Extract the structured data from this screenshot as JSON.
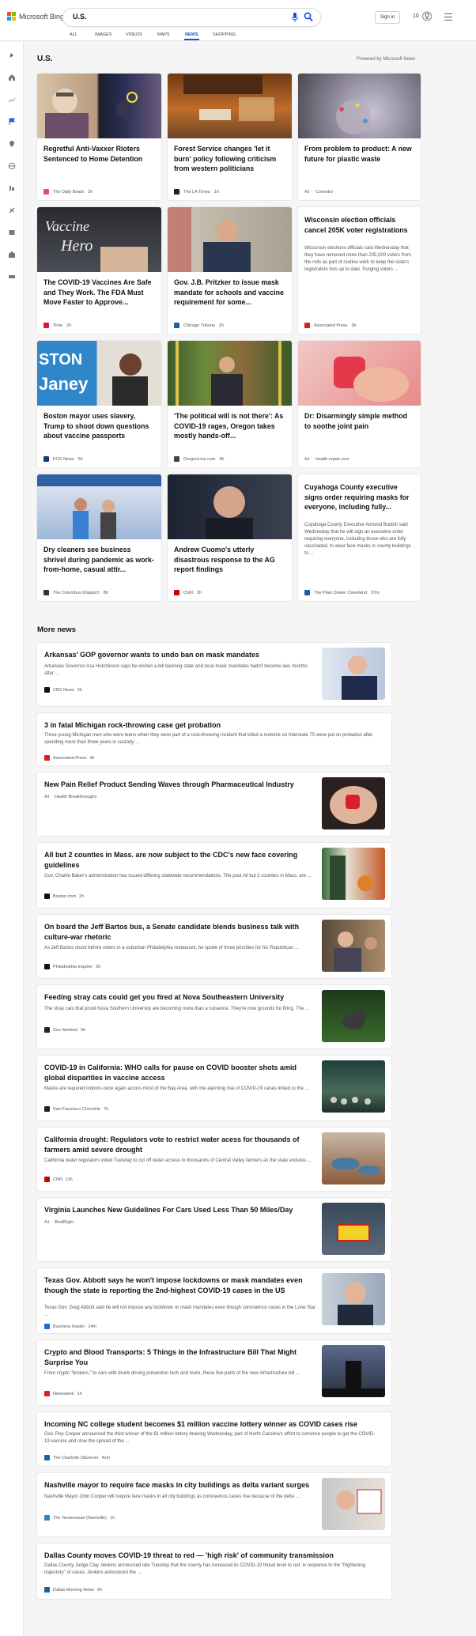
{
  "header": {
    "brand": "Microsoft Bing",
    "query": "U.S.",
    "signin": "Sign in",
    "points": "10",
    "tabs": [
      "ALL",
      "IMAGES",
      "VIDEOS",
      "MAPS",
      "NEWS",
      "SHOPPING"
    ],
    "active_tab": "NEWS"
  },
  "section": {
    "title": "U.S.",
    "powered": "Powered by Microsoft News",
    "more_news": "More news"
  },
  "cards": [
    {
      "title": "Regretful Anti-Vaxxer Rioters Sentenced to Home Detention",
      "source": "The Daily Beast",
      "time": "1h",
      "fav_color": "#e74c6d"
    },
    {
      "title": "Forest Service changes 'let it burn' policy following criticism from western politicians",
      "source": "The LA Times",
      "time": "1h",
      "fav_color": "#222222"
    },
    {
      "title": "From problem to product: A new future for plastic waste",
      "ad": "Ad",
      "source": "Covestro",
      "time": ""
    },
    {
      "title": "The COVID-19 Vaccines Are Safe and They Work. The FDA Must Move Faster to Approve...",
      "source": "Time",
      "time": "2h",
      "fav_color": "#d81b28"
    },
    {
      "title": "Gov. J.B. Pritzker to issue mask mandate for schools and vaccine requirement for some...",
      "source": "Chicago Tribune",
      "time": "2h",
      "fav_color": "#1c5fa8"
    },
    {
      "title": "Wisconsin election officials cancel 205K voter registrations",
      "desc": "Wisconsin elections officials said Wednesday that they have removed more than 205,000 voters from the rolls as part of routine work to keep the state's registration lists up to date. Purging voters ...",
      "source": "Associated Press",
      "time": "3h",
      "fav_color": "#d6202a"
    },
    {
      "title": "Boston mayor uses slavery, Trump to shoot down questions about vaccine passports",
      "source": "FOX News",
      "time": "5h",
      "fav_color": "#173a7c"
    },
    {
      "title": "'The political will is not there': As COVID-19 rages, Oregon takes mostly hands-off...",
      "source": "OregonLive.com",
      "time": "4h",
      "fav_color": "#444444"
    },
    {
      "title": "Dr: Disarmingly simple method to soothe joint pain",
      "ad": "Ad",
      "source": "health-repair.com",
      "time": ""
    },
    {
      "title": "Dry cleaners see business shrivel during pandemic as work-from-home, casual attir...",
      "source": "The Columbus Dispatch",
      "time": "8h",
      "fav_color": "#333333"
    },
    {
      "title": "Andrew Cuomo's utterly disastrous response to the AG report findings",
      "source": "CNN",
      "time": "2h",
      "fav_color": "#cc0000"
    },
    {
      "title": "Cuyahoga County executive signs order requiring masks for everyone, including fully...",
      "desc": "Cuyahoga County Executive Armond Budish said Wednesday that he will sign an executive order requiring everyone, including those who are fully vaccinated, to wear face masks in county buildings to ...",
      "source": "The Plain Dealer Cleveland",
      "time": "37m",
      "fav_color": "#1f5fa0"
    }
  ],
  "news": [
    {
      "title": "Arkansas' GOP governor wants to undo ban on mask mandates",
      "desc": "Arkansas Governor Asa Hutchinson says he wishes a bill banning state and local mask mandates hadn't become law, months after ...",
      "source": "CBS News",
      "time": "3h",
      "fav_color": "#111111"
    },
    {
      "title": "3 in fatal Michigan rock-throwing case get probation",
      "desc": "Three young Michigan men who were teens when they were part of a rock-throwing incident that killed a motorist on Interstate 75 were put on probation after spending more than three years in custody ...",
      "source": "Associated Press",
      "time": "3h",
      "fav_color": "#d6202a"
    },
    {
      "title": "New Pain Relief Product Sending Waves through Pharmaceutical Industry",
      "ad": "Ad",
      "source": "Health Breakthroughs",
      "time": ""
    },
    {
      "title": "All but 2 counties in Mass. are now subject to the CDC's new face covering guidelines",
      "desc": "Gov. Charlie Baker's administration has issued differing statewide recommendations. The post All but 2 counties in Mass. are ...",
      "source": "Boston.com",
      "time": "2h",
      "fav_color": "#111111"
    },
    {
      "title": "On board the Jeff Bartos bus, a Senate candidate blends business talk with culture-war rhetoric",
      "desc": "As Jeff Bartos stood before voters in a suburban Philadelphia restaurant, he spoke of three priorities for his Republican ...",
      "source": "Philadelphia Inquirer",
      "time": "3h",
      "fav_color": "#111111"
    },
    {
      "title": "Feeding stray cats could get you fired at Nova Southeastern University",
      "desc": "The stray cats that prowl Nova Southern University are becoming more than a nuisance. They're now grounds for firing. The ...",
      "source": "Sun Sentinel",
      "time": "5h",
      "fav_color": "#222222"
    },
    {
      "title": "COVID-19 in California: WHO calls for pause on COVID booster shots amid global disparities in vaccine access",
      "desc": "Masks are required indoors once again across most of the Bay Area, with the alarming rise of COVID-19 cases linked to the ...",
      "source": "San Francisco Chronicle",
      "time": "7h",
      "fav_color": "#222222"
    },
    {
      "title": "California drought: Regulators vote to restrict water acess for thousands of farmers amid severe drought",
      "desc": "California water regulators voted Tuesday to cut off water access to thousands of Central Valley farmers as the state endures ...",
      "source": "CNN",
      "time": "11h",
      "fav_color": "#cc0000"
    },
    {
      "title": "Virginia Launches New Guidelines For Cars Used Less Than 50 Miles/Day",
      "ad": "Ad",
      "source": "BindRight",
      "time": ""
    },
    {
      "title": "Texas Gov. Abbott says he won't impose lockdowns or mask mandates even though the state is reporting the 2nd-highest COVID-19 cases in the US",
      "desc": "Texas Gov. Greg Abbott said he will not impose any lockdown or mask mandates even though coronavirus cases in the Lone Star ...",
      "source": "Business Insider",
      "time": "14m",
      "fav_color": "#1d6bd6"
    },
    {
      "title": "Crypto and Blood Transports: 5 Things in the Infrastructure Bill That Might Surprise You",
      "desc": "From crypto \"brokers,\" to cars with drunk driving prevention tech and more, these five parts of the new infrastructure bill ...",
      "source": "Newsweek",
      "time": "1h",
      "fav_color": "#d6202a"
    },
    {
      "title": "Incoming NC college student becomes $1 million vaccine lottery winner as COVID cases rise",
      "desc": "Gov. Roy Cooper announced the third winner of the $1 million lottery drawing Wednesday, part of North Carolina's effort to convince people to get the COVID-19 vaccine and slow the spread of the ...",
      "source": "The Charlotte Observer",
      "time": "41m",
      "fav_color": "#1f5fa0"
    },
    {
      "title": "Nashville mayor to require face masks in city buildings as delta variant surges",
      "desc": "Nashville Mayor John Cooper will require face masks in all city buildings as coronavirus cases rise because of the delta ...",
      "source": "The Tennessean (Nashville)",
      "time": "1h",
      "fav_color": "#2e86c1"
    },
    {
      "title": "Dallas County moves COVID-19 threat to red — 'high risk' of community transmission",
      "desc": "Dallas County Judge Clay Jenkins announced late Tuesday that the county has increased its COVID-19 threat level to red, in response to the \"frightening trajectory\" of cases. Jenkins announced the ...",
      "source": "Dallas Morning News",
      "time": "6h",
      "fav_color": "#1f5fa0"
    }
  ]
}
